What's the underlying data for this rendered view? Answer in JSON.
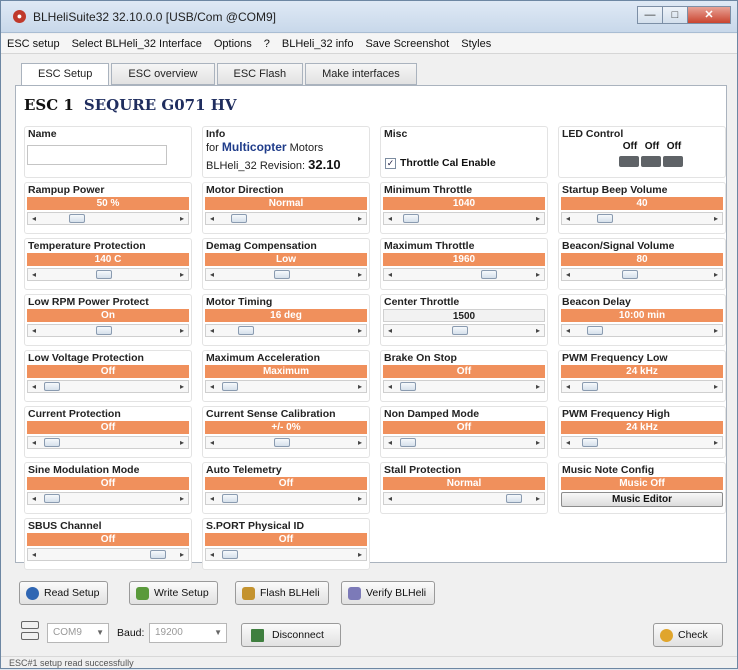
{
  "window": {
    "title": "BLHeliSuite32 32.10.0.0 [USB/Com @COM9]",
    "minimize_glyph": "—",
    "maximize_glyph": "□",
    "close_glyph": "✕"
  },
  "menu": [
    "ESC setup",
    "Select BLHeli_32 Interface",
    "Options",
    "?",
    "BLHeli_32 info",
    "Save Screenshot",
    "Styles"
  ],
  "tabs": [
    "ESC Setup",
    "ESC overview",
    "ESC Flash",
    "Make interfaces"
  ],
  "esc": {
    "number": "ESC 1",
    "name": "SEQURE G071 HV"
  },
  "name_cell": {
    "label": "Name",
    "value": ""
  },
  "info_cell": {
    "label": "Info",
    "for_prefix": "for",
    "type": "Multicopter",
    "motors_suffix": "Motors",
    "revision_label": "BLHeli_32 Revision:",
    "revision": "32.10"
  },
  "misc_cell": {
    "label": "Misc",
    "checkbox_label": "Throttle Cal Enable",
    "checked": true
  },
  "led_cell": {
    "label": "LED Control",
    "states": [
      "Off",
      "Off",
      "Off"
    ]
  },
  "params": [
    {
      "label": "Rampup Power",
      "value": "50 %",
      "level": 0.25
    },
    {
      "label": "Motor Direction",
      "value": "Normal",
      "level": 0.12
    },
    {
      "label": "Minimum Throttle",
      "value": "1040",
      "level": 0.07
    },
    {
      "label": "Startup Beep Volume",
      "value": "40",
      "level": 0.2
    },
    {
      "label": "Temperature Protection",
      "value": "140 C",
      "level": 0.47
    },
    {
      "label": "Demag Compensation",
      "value": "Low",
      "level": 0.47
    },
    {
      "label": "Maximum Throttle",
      "value": "1960",
      "level": 0.7
    },
    {
      "label": "Beacon/Signal Volume",
      "value": "80",
      "level": 0.4
    },
    {
      "label": "Low RPM Power Protect",
      "value": "On",
      "level": 0.47
    },
    {
      "label": "Motor Timing",
      "value": "16 deg",
      "level": 0.18
    },
    {
      "label": "Center Throttle",
      "value": "1500",
      "level": 0.47,
      "plain": true
    },
    {
      "label": "Beacon Delay",
      "value": "10:00 min",
      "level": 0.12
    },
    {
      "label": "Low Voltage Protection",
      "value": "Off",
      "level": 0.05
    },
    {
      "label": "Maximum Acceleration",
      "value": "Maximum",
      "level": 0.05
    },
    {
      "label": "Brake On Stop",
      "value": "Off",
      "level": 0.05
    },
    {
      "label": "PWM Frequency Low",
      "value": "24 kHz",
      "level": 0.08
    },
    {
      "label": "Current Protection",
      "value": "Off",
      "level": 0.05
    },
    {
      "label": "Current Sense Calibration",
      "value": "+/- 0%",
      "level": 0.47
    },
    {
      "label": "Non Damped Mode",
      "value": "Off",
      "level": 0.05
    },
    {
      "label": "PWM Frequency High",
      "value": "24 kHz",
      "level": 0.08
    },
    {
      "label": "Sine Modulation Mode",
      "value": "Off",
      "level": 0.05
    },
    {
      "label": "Auto Telemetry",
      "value": "Off",
      "level": 0.05
    },
    {
      "label": "Stall Protection",
      "value": "Normal",
      "level": 0.9
    },
    {
      "label": "Music Note Config",
      "value": "Music Off",
      "button": "Music Editor"
    },
    {
      "label": "SBUS Channel",
      "value": "Off",
      "level": 0.9
    },
    {
      "label": "S.PORT Physical ID",
      "value": "Off",
      "level": 0.05
    }
  ],
  "toolbar": {
    "read": "Read Setup",
    "write": "Write Setup",
    "flash": "Flash BLHeli",
    "verify": "Verify BLHeli"
  },
  "connection": {
    "port": "COM9",
    "baud_label": "Baud:",
    "baud": "19200",
    "disconnect": "Disconnect",
    "check": "Check"
  },
  "status": "ESC#1 setup read successfully",
  "colors": {
    "value_bg": "#f0905c",
    "title_blue": "#1f2d5e"
  }
}
